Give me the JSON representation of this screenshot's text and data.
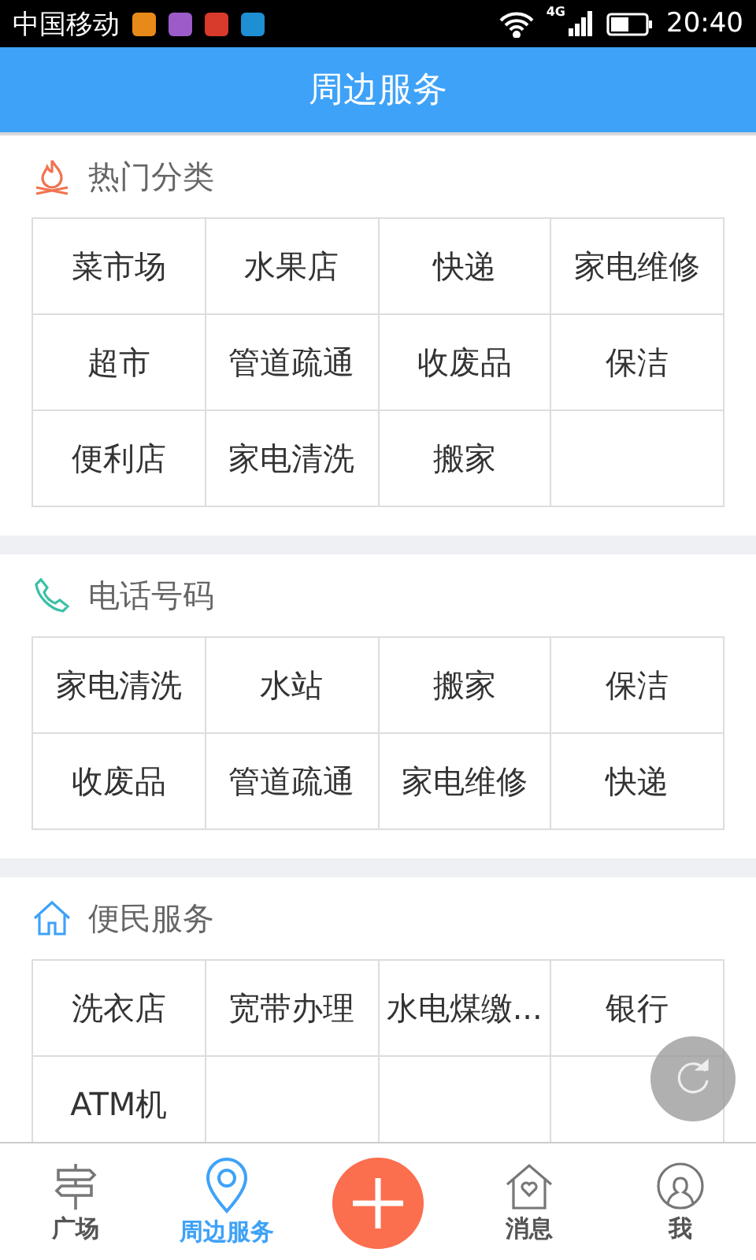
{
  "status_bar": {
    "carrier": "中国移动",
    "network": "4G",
    "time": "20:40"
  },
  "header": {
    "title": "周边服务"
  },
  "sections": [
    {
      "kind": "fire",
      "title": "热门分类",
      "items": [
        "菜市场",
        "水果店",
        "快递",
        "家电维修",
        "超市",
        "管道疏通",
        "收废品",
        "保洁",
        "便利店",
        "家电清洗",
        "搬家"
      ]
    },
    {
      "kind": "phone",
      "title": "电话号码",
      "items": [
        "家电清洗",
        "水站",
        "搬家",
        "保洁",
        "收废品",
        "管道疏通",
        "家电维修",
        "快递"
      ]
    },
    {
      "kind": "house",
      "title": "便民服务",
      "items": [
        "洗衣店",
        "宽带办理",
        "水电煤缴...",
        "银行",
        "ATM机"
      ]
    }
  ],
  "nav": [
    {
      "kind": "sign",
      "label": "广场",
      "selected": false
    },
    {
      "kind": "pin",
      "label": "周边服务",
      "selected": true
    },
    {
      "kind": "plus"
    },
    {
      "kind": "home",
      "label": "消息",
      "selected": false
    },
    {
      "kind": "user",
      "label": "我",
      "selected": false
    }
  ]
}
